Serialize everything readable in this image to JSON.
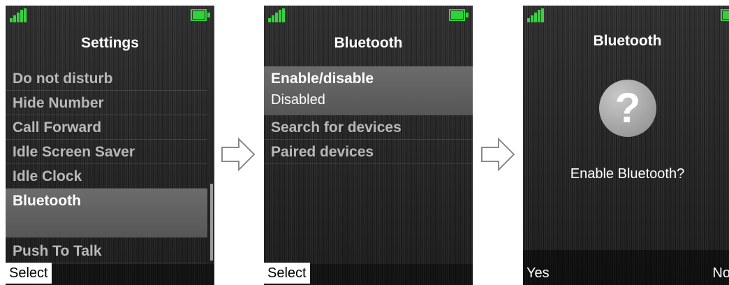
{
  "screen1": {
    "title": "Settings",
    "items": [
      "Do not disturb",
      "Hide Number",
      "Call Forward",
      "Idle Screen Saver",
      "Idle Clock",
      "Bluetooth",
      "Push To Talk"
    ],
    "softkey_left": "Select"
  },
  "screen2": {
    "title": "Bluetooth",
    "selected_item": "Enable/disable",
    "selected_value": "Disabled",
    "items": [
      "Search for devices",
      "Paired devices"
    ],
    "softkey_left": "Select"
  },
  "screen3": {
    "title": "Bluetooth",
    "icon": "question-icon",
    "icon_glyph": "?",
    "prompt": "Enable Bluetooth?",
    "softkey_left": "Yes",
    "softkey_right": "No"
  },
  "colors": {
    "status_green": "#38d13f",
    "highlight": "#606060",
    "text": "#ffffff",
    "inactive_text": "#b8b8b8"
  }
}
